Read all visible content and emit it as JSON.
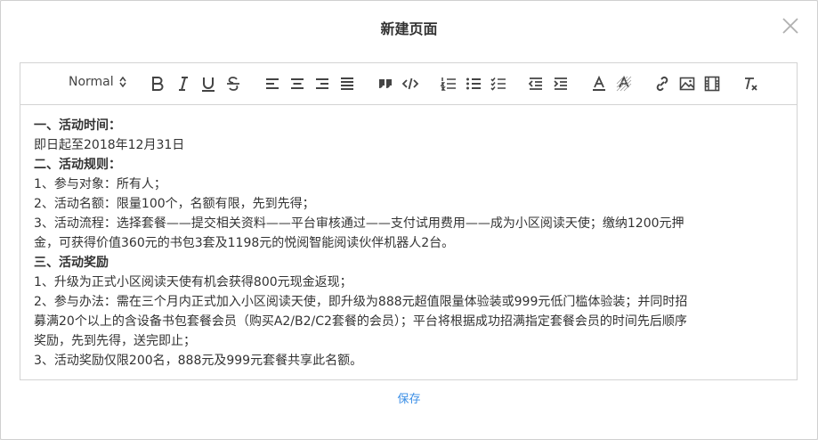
{
  "dialog": {
    "title": "新建页面",
    "save_label": "保存"
  },
  "toolbar": {
    "header_value": "Normal",
    "buttons": [
      "bold-icon",
      "italic-icon",
      "underline-icon",
      "strikethrough-icon",
      "align-left-icon",
      "align-center-icon",
      "align-right-icon",
      "align-justify-icon",
      "blockquote-icon",
      "code-icon",
      "ordered-list-icon",
      "bullet-list-icon",
      "check-list-icon",
      "outdent-icon",
      "indent-icon",
      "text-color-icon",
      "background-color-icon",
      "link-icon",
      "image-icon",
      "video-icon",
      "clear-format-icon"
    ]
  },
  "content": {
    "lines": [
      {
        "text": "一、活动时间：",
        "bold": true
      },
      {
        "text": "即日起至2018年12月31日",
        "bold": false
      },
      {
        "text": "二、活动规则：",
        "bold": true
      },
      {
        "text": "1、参与对象：所有人；",
        "bold": false
      },
      {
        "text": "2、活动名额：限量100个，名额有限，先到先得；",
        "bold": false
      },
      {
        "text": "3、活动流程：选择套餐——提交相关资料——平台审核通过——支付试用费用——成为小区阅读天使；缴纳1200元押",
        "bold": false
      },
      {
        "text": "金，可获得价值360元的书包3套及1198元的悦阅智能阅读伙伴机器人2台。",
        "bold": false
      },
      {
        "text": "三、活动奖励",
        "bold": true
      },
      {
        "text": "1、升级为正式小区阅读天使有机会获得800元现金返现；",
        "bold": false
      },
      {
        "text": "2、参与办法：需在三个月内正式加入小区阅读天使，即升级为888元超值限量体验装或999元低门槛体验装；并同时招",
        "bold": false
      },
      {
        "text": "募满20个以上的含设备书包套餐会员（购买A2/B2/C2套餐的会员）；平台将根据成功招满指定套餐会员的时间先后顺序",
        "bold": false
      },
      {
        "text": "奖励，先到先得，送完即止；",
        "bold": false
      },
      {
        "text": "3、活动奖励仅限200名，888元及999元套餐共享此名额。",
        "bold": false
      }
    ]
  }
}
